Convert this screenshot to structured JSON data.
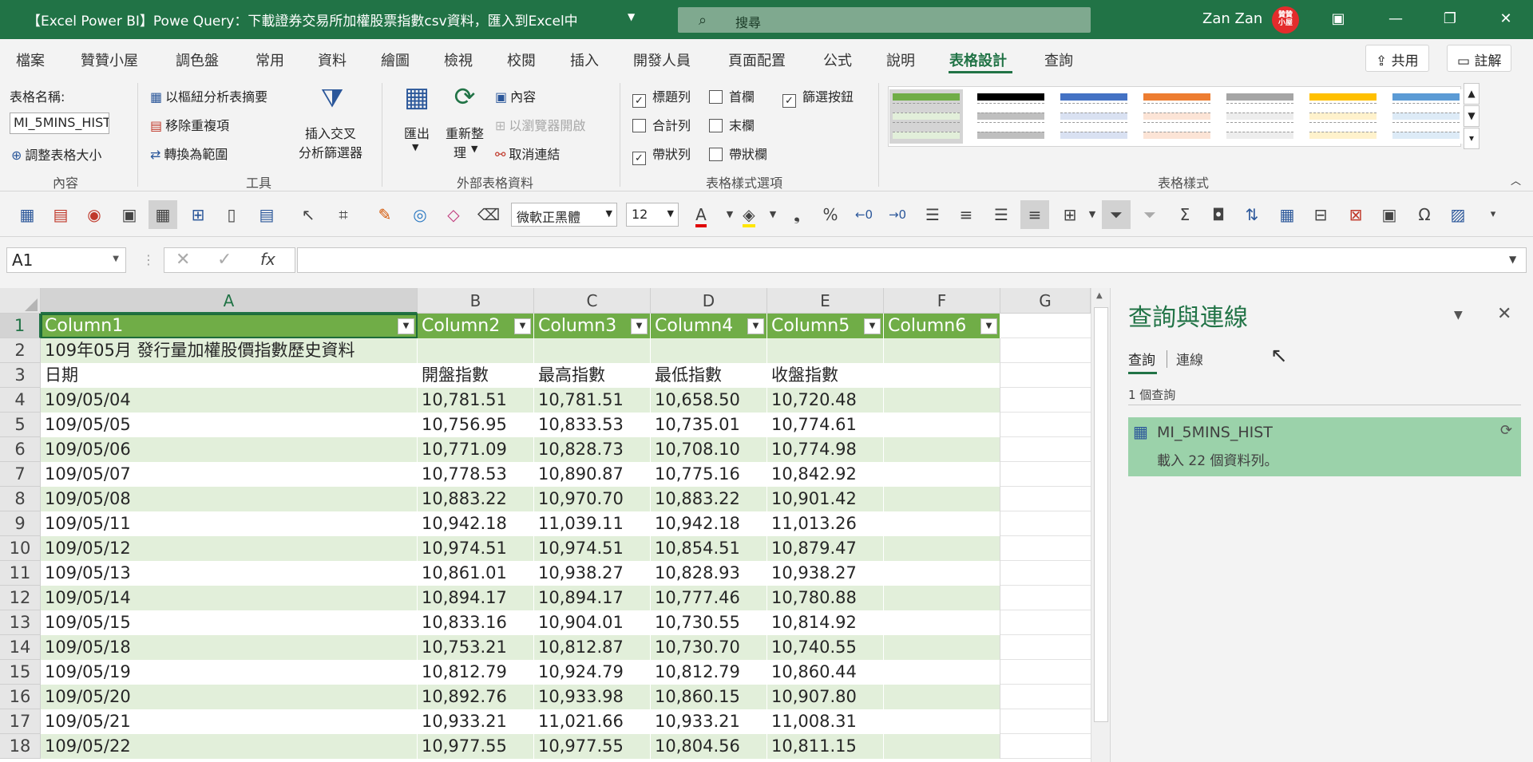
{
  "titlebar": {
    "title": "【Excel Power BI】Powe Query：下載證券交易所加權股票指數csv資料，匯入到Excel中",
    "search_placeholder": "搜尋",
    "user_name": "Zan Zan",
    "avatar_text": "贊贊小屋"
  },
  "menu": {
    "tabs": [
      "檔案",
      "贊贊小屋",
      "調色盤",
      "常用",
      "資料",
      "繪圖",
      "檢視",
      "校閱",
      "插入",
      "開發人員",
      "頁面配置",
      "公式",
      "說明",
      "表格設計",
      "查詢"
    ],
    "share_label": "共用",
    "comment_label": "註解"
  },
  "ribbon": {
    "props": {
      "table_name_label": "表格名稱:",
      "table_name_value": "MI_5MINS_HIST",
      "resize_label": "調整表格大小",
      "group": "內容"
    },
    "tools": {
      "pivot_label": "以樞紐分析表摘要",
      "remove_dup_label": "移除重複項",
      "convert_label": "轉換為範圍",
      "slicer_line1": "插入交叉",
      "slicer_line2": "分析篩選器",
      "group": "工具"
    },
    "external": {
      "export_label": "匯出",
      "refresh_line1": "重新整",
      "refresh_line2": "理",
      "properties_label": "內容",
      "open_browser_label": "以瀏覽器開啟",
      "unlink_label": "取消連結",
      "group": "外部表格資料"
    },
    "style_options": {
      "header_row": "標題列",
      "total_row": "合計列",
      "banded_rows": "帶狀列",
      "first_column": "首欄",
      "last_column": "末欄",
      "banded_columns": "帶狀欄",
      "filter_button": "篩選按鈕",
      "group": "表格樣式選項"
    },
    "styles_group": "表格樣式"
  },
  "quickbar": {
    "font_name": "微軟正黑體",
    "font_size": "12"
  },
  "formula": {
    "name_box": "A1",
    "value": ""
  },
  "sheet": {
    "columns": [
      "A",
      "B",
      "C",
      "D",
      "E",
      "F",
      "G"
    ],
    "header_row": [
      "Column1",
      "Column2",
      "Column3",
      "Column4",
      "Column5",
      "Column6"
    ],
    "title_row": "109年05月 發行量加權股價指數歷史資料",
    "label_row": [
      "日期",
      "開盤指數",
      "最高指數",
      "最低指數",
      "收盤指數"
    ],
    "row_numbers": [
      "1",
      "2",
      "3",
      "4",
      "5",
      "6",
      "7",
      "8",
      "9",
      "10",
      "11",
      "12",
      "13",
      "14",
      "15",
      "16",
      "17",
      "18"
    ],
    "data_rows": [
      [
        "109/05/04",
        "10,781.51",
        "10,781.51",
        "10,658.50",
        "10,720.48"
      ],
      [
        "109/05/05",
        "10,756.95",
        "10,833.53",
        "10,735.01",
        "10,774.61"
      ],
      [
        "109/05/06",
        "10,771.09",
        "10,828.73",
        "10,708.10",
        "10,774.98"
      ],
      [
        "109/05/07",
        "10,778.53",
        "10,890.87",
        "10,775.16",
        "10,842.92"
      ],
      [
        "109/05/08",
        "10,883.22",
        "10,970.70",
        "10,883.22",
        "10,901.42"
      ],
      [
        "109/05/11",
        "10,942.18",
        "11,039.11",
        "10,942.18",
        "11,013.26"
      ],
      [
        "109/05/12",
        "10,974.51",
        "10,974.51",
        "10,854.51",
        "10,879.47"
      ],
      [
        "109/05/13",
        "10,861.01",
        "10,938.27",
        "10,828.93",
        "10,938.27"
      ],
      [
        "109/05/14",
        "10,894.17",
        "10,894.17",
        "10,777.46",
        "10,780.88"
      ],
      [
        "109/05/15",
        "10,833.16",
        "10,904.01",
        "10,730.55",
        "10,814.92"
      ],
      [
        "109/05/18",
        "10,753.21",
        "10,812.87",
        "10,730.70",
        "10,740.55"
      ],
      [
        "109/05/19",
        "10,812.79",
        "10,924.79",
        "10,812.79",
        "10,860.44"
      ],
      [
        "109/05/20",
        "10,892.76",
        "10,933.98",
        "10,860.15",
        "10,907.80"
      ],
      [
        "109/05/21",
        "10,933.21",
        "11,021.66",
        "10,933.21",
        "11,008.31"
      ],
      [
        "109/05/22",
        "10,977.55",
        "10,977.55",
        "10,804.56",
        "10,811.15"
      ]
    ]
  },
  "pane": {
    "title": "查詢與連線",
    "tab_queries": "查詢",
    "tab_connections": "連線",
    "count_label": "1 個查詢",
    "query_name": "MI_5MINS_HIST",
    "query_status": "載入 22 個資料列。"
  },
  "colors": {
    "accent": "#217346",
    "table_header": "#70ad47",
    "band": "#e2efda"
  }
}
